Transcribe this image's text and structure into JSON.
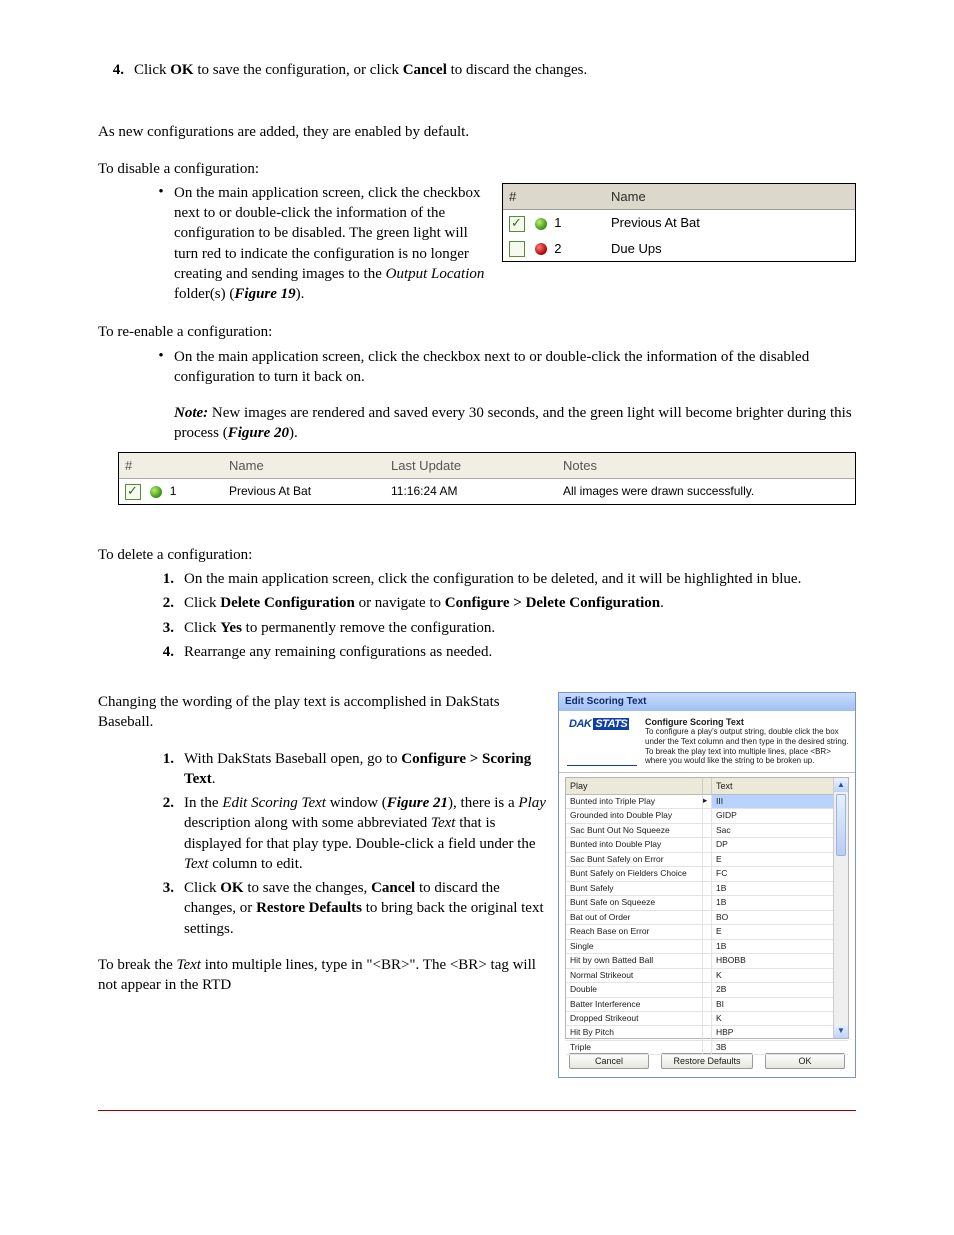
{
  "step4": {
    "num": "4.",
    "pre": "Click ",
    "ok": "OK",
    "mid": " to save the configuration, or click ",
    "cancel": "Cancel",
    "post": " to discard the changes."
  },
  "enabled_default": "As new configurations are added, they are enabled by default.",
  "disable_heading": "To disable a configuration:",
  "disable_bullet_a": "On the main application screen, click the checkbox next to or double-click the information of the configuration to be disabled. The green light will turn red to indicate the configuration is no longer creating and sending images to the ",
  "disable_bullet_b": "Output Location",
  "disable_bullet_c": " folder(s) (",
  "disable_bullet_d": "Figure 19",
  "disable_bullet_e": ").",
  "fig19": {
    "head_num": "#",
    "head_name": "Name",
    "rows": [
      {
        "num": "1",
        "name": "Previous At Bat",
        "checked": true,
        "green": true
      },
      {
        "num": "2",
        "name": "Due Ups",
        "checked": false,
        "green": false
      }
    ]
  },
  "reenable_heading": "To re-enable a configuration:",
  "reenable_bullet": "On the main application screen, click the checkbox next to or double-click the information of the disabled configuration to turn it back on.",
  "note_label": "Note:",
  "note_a": " New images are rendered and saved every 30 seconds, and the green light will become brighter during this process (",
  "note_b": "Figure 20",
  "note_c": ").",
  "fig20": {
    "head_num": "#",
    "head_name": "Name",
    "head_upd": "Last Update",
    "head_notes": "Notes",
    "row": {
      "num": "1",
      "name": "Previous At Bat",
      "upd": "11:16:24 AM",
      "notes": "All images were drawn successfully."
    }
  },
  "delete_heading": "To delete a configuration:",
  "delete_steps": [
    {
      "num": "1.",
      "text": "On the main application screen, click the configuration to be deleted, and it will be highlighted in blue."
    },
    {
      "num": "2.",
      "pre": "Click ",
      "b1": "Delete Configuration",
      "mid": " or navigate to ",
      "b2": "Configure > Delete Configuration",
      "post": "."
    },
    {
      "num": "3.",
      "pre": "Click ",
      "b1": "Yes",
      "post": " to permanently remove the configuration."
    },
    {
      "num": "4.",
      "text": "Rearrange any remaining configurations as needed."
    }
  ],
  "scoring_intro": "Changing the wording of the play text is accomplished in DakStats Baseball.",
  "scoring_steps": {
    "s1": {
      "num": "1.",
      "pre": "With DakStats Baseball open, go to ",
      "b": "Configure > Scoring Text",
      "post": "."
    },
    "s2": {
      "num": "2.",
      "a": "In the ",
      "b": "Edit Scoring Text",
      "c": " window (",
      "d": "Figure 21",
      "e": "), there is a ",
      "f": "Play",
      "g": " description along with some abbreviated ",
      "h": "Text",
      "i": " that is displayed for that play type. Double-click a field under the ",
      "j": "Text",
      "k": " column to edit."
    },
    "s3": {
      "num": "3.",
      "a": "Click ",
      "b": "OK",
      "c": " to save the changes, ",
      "d": "Cancel",
      "e": " to discard the changes, or ",
      "f": "Restore Defaults",
      "g": " to bring back the original text settings."
    }
  },
  "break_a": "To break the ",
  "break_b": "Text",
  "break_c": " into multiple lines, type in \"<BR>\". The <BR> tag will not appear in the RTD",
  "fig21": {
    "title": "Edit Scoring Text",
    "instr_title": "Configure Scoring Text",
    "instr_body": "To configure a play's output string, double click the box under the Text column and then type in the desired string. To break the play text into multiple lines, place <BR> where you would like the string to be broken up.",
    "logo_a": "DAK",
    "logo_b": "STATS",
    "col_play": "Play",
    "col_text": "Text",
    "rows": [
      {
        "play": "Bunted into Triple Play",
        "text": "III",
        "sel": true
      },
      {
        "play": "Grounded into Double Play",
        "text": "GIDP"
      },
      {
        "play": "Sac Bunt Out No Squeeze",
        "text": "Sac"
      },
      {
        "play": "Bunted into Double Play",
        "text": "DP"
      },
      {
        "play": "Sac Bunt Safely on Error",
        "text": "E"
      },
      {
        "play": "Bunt Safely on Fielders Choice",
        "text": "FC"
      },
      {
        "play": "Bunt Safely",
        "text": "1B"
      },
      {
        "play": "Bunt Safe on Squeeze",
        "text": "1B"
      },
      {
        "play": "Bat out of Order",
        "text": "BO"
      },
      {
        "play": "Reach Base on Error",
        "text": "E"
      },
      {
        "play": "Single",
        "text": "1B"
      },
      {
        "play": "Hit by own Batted Ball",
        "text": "HBOBB"
      },
      {
        "play": "Normal Strikeout",
        "text": "K"
      },
      {
        "play": "Double",
        "text": "2B"
      },
      {
        "play": "Batter Interference",
        "text": "BI"
      },
      {
        "play": "Dropped Strikeout",
        "text": "K"
      },
      {
        "play": "Hit By Pitch",
        "text": "HBP"
      },
      {
        "play": "Triple",
        "text": "3B"
      }
    ],
    "btn_cancel": "Cancel",
    "btn_restore": "Restore Defaults",
    "btn_ok": "OK"
  }
}
